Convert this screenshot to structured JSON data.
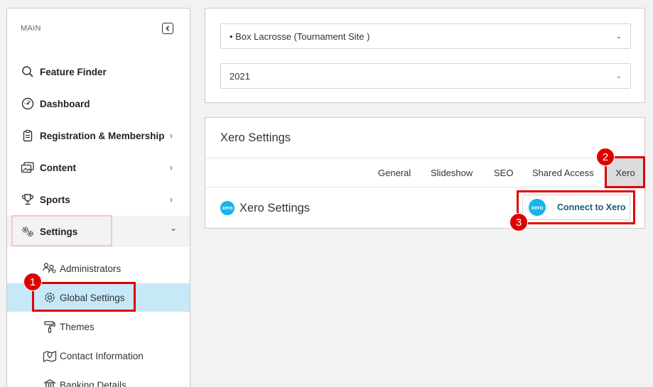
{
  "sidebar": {
    "header": "MAIN",
    "items": [
      {
        "label": "Feature Finder",
        "icon": "search-icon",
        "chevron": ""
      },
      {
        "label": "Dashboard",
        "icon": "dashboard-icon",
        "chevron": ""
      },
      {
        "label": "Registration & Membership",
        "icon": "clipboard-icon",
        "chevron": "›"
      },
      {
        "label": "Content",
        "icon": "image-gallery-icon",
        "chevron": "›"
      },
      {
        "label": "Sports",
        "icon": "trophy-icon",
        "chevron": "›"
      },
      {
        "label": "Settings",
        "icon": "settings-gears-icon",
        "chevron": "⌄"
      }
    ],
    "subitems": [
      {
        "label": "Administrators",
        "icon": "users-icon"
      },
      {
        "label": "Global Settings",
        "icon": "gear-icon"
      },
      {
        "label": "Themes",
        "icon": "paint-roller-icon"
      },
      {
        "label": "Contact Information",
        "icon": "map-pin-icon"
      },
      {
        "label": "Banking Details",
        "icon": "bank-icon"
      }
    ]
  },
  "filters": {
    "site": "• Box Lacrosse (Tournament Site )",
    "year": "2021",
    "chevron": "⌄"
  },
  "xero": {
    "panel_title": "Xero Settings",
    "tabs": [
      "General",
      "Slideshow",
      "SEO",
      "Shared Access",
      "Xero"
    ],
    "active_tab": "Xero",
    "row_title": "Xero Settings",
    "logo_text": "xero",
    "connect_label": "Connect to Xero"
  },
  "annotations": [
    "1",
    "2",
    "3"
  ],
  "colors": {
    "highlight": "#e00000",
    "selected_bg": "#c6e8f7",
    "xero_brand": "#13b5ea"
  }
}
